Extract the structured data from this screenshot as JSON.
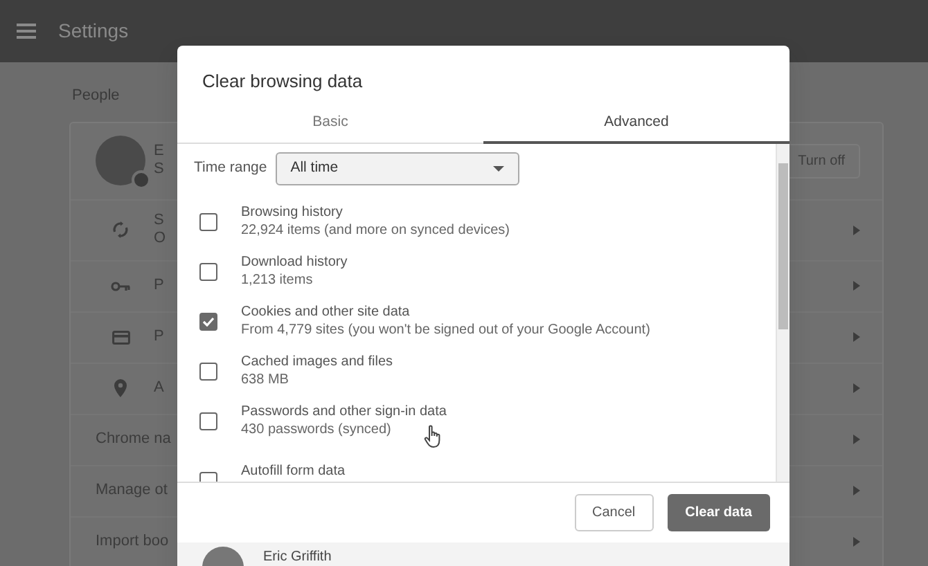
{
  "app_bar": {
    "title": "Settings"
  },
  "section": {
    "title": "People"
  },
  "people_rows": [
    {
      "kind": "account",
      "letters": [
        "E",
        "S"
      ],
      "button": "Turn off"
    },
    {
      "kind": "sync",
      "letters": [
        "S",
        "O"
      ]
    },
    {
      "kind": "key",
      "letters": [
        "P"
      ]
    },
    {
      "kind": "card",
      "letters": [
        "P"
      ]
    },
    {
      "kind": "pin",
      "letters": [
        "A"
      ]
    },
    {
      "kind": "text",
      "label": "Chrome na"
    },
    {
      "kind": "text",
      "label": "Manage ot"
    },
    {
      "kind": "text",
      "label": "Import boo"
    }
  ],
  "dialog": {
    "title": "Clear browsing data",
    "tabs": [
      {
        "label": "Basic",
        "selected": false
      },
      {
        "label": "Advanced",
        "selected": true
      }
    ],
    "time_range": {
      "label": "Time range",
      "value": "All time"
    },
    "items": [
      {
        "title": "Browsing history",
        "detail": "22,924 items (and more on synced devices)",
        "checked": false
      },
      {
        "title": "Download history",
        "detail": "1,213 items",
        "checked": false
      },
      {
        "title": "Cookies and other site data",
        "detail": "From 4,779 sites (you won't be signed out of your Google Account)",
        "checked": true
      },
      {
        "title": "Cached images and files",
        "detail": "638 MB",
        "checked": false
      },
      {
        "title": "Passwords and other sign-in data",
        "detail": "430 passwords (synced)",
        "checked": false
      },
      {
        "title": "Autofill form data",
        "checked": false
      }
    ],
    "buttons": [
      {
        "label": "Cancel",
        "kind": "secondary"
      },
      {
        "label": "Clear data",
        "kind": "primary"
      }
    ],
    "account": {
      "name": "Eric Griffith"
    }
  }
}
